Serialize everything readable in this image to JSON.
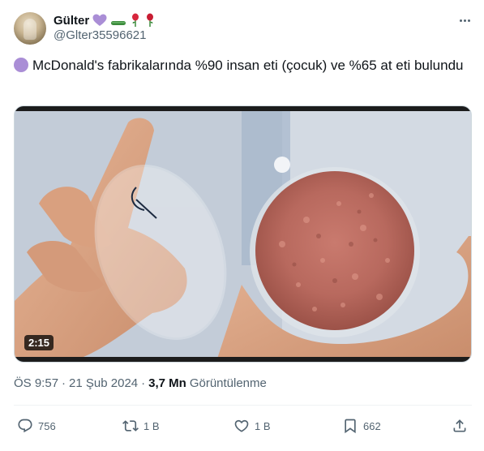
{
  "author": {
    "display_name": "Gülter",
    "handle": "@Glter35596621",
    "name_emojis": [
      "purple-heart",
      "cucumber",
      "rose",
      "rose"
    ]
  },
  "tweet": {
    "text": "McDonald's fabrikalarında %90 insan eti (çocuk) ve %65 at eti bulundu",
    "leading_emoji": "purple-circle"
  },
  "media": {
    "duration": "2:15"
  },
  "meta": {
    "time": "ÖS 9:57",
    "date": "21 Şub 2024",
    "views_count": "3,7 Mn",
    "views_label": "Görüntülenme"
  },
  "actions": {
    "replies": "756",
    "retweets": "1 B",
    "likes": "1 B",
    "bookmarks": "662"
  },
  "colors": {
    "text": "#0f1419",
    "secondary": "#536471",
    "divider": "#eff3f4",
    "emoji_purple": "#aa8ed6"
  }
}
